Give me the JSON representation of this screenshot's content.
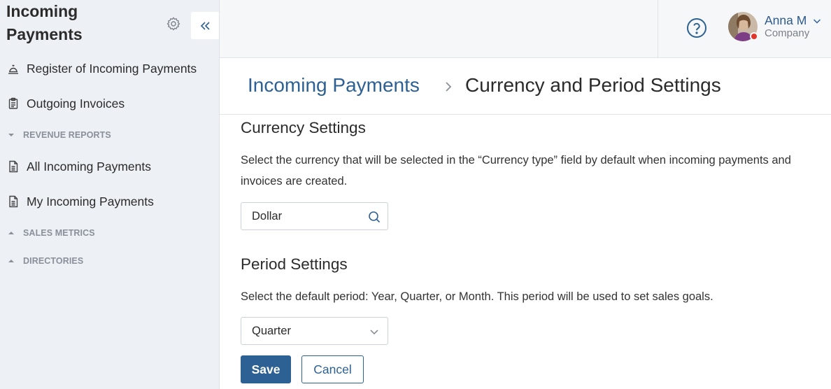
{
  "sidebar": {
    "title": "Incoming Payments",
    "items": [
      {
        "label": "Register of Incoming Payments",
        "icon": "bell-register-icon"
      },
      {
        "label": "Outgoing Invoices",
        "icon": "clipboard-icon"
      },
      {
        "label": "All Incoming Payments",
        "icon": "document-icon"
      },
      {
        "label": "My Incoming Payments",
        "icon": "document-icon"
      }
    ],
    "groups": [
      {
        "label": "REVENUE REPORTS",
        "state": "expanded"
      },
      {
        "label": "SALES METRICS",
        "state": "collapsed"
      },
      {
        "label": "DIRECTORIES",
        "state": "collapsed"
      }
    ]
  },
  "header": {
    "user_name": "Anna M",
    "user_company": "Company"
  },
  "breadcrumb": {
    "parent": "Incoming Payments",
    "current": "Currency and Period Settings"
  },
  "currency": {
    "title": "Currency Settings",
    "description": "Select the currency that will be selected in the “Currency type” field by default when incoming payments and invoices are created.",
    "value": "Dollar"
  },
  "period": {
    "title": "Period Settings",
    "description": "Select the default period: Year, Quarter, or Month. This period will be used to set sales goals.",
    "value": "Quarter"
  },
  "actions": {
    "save": "Save",
    "cancel": "Cancel"
  },
  "colors": {
    "accent": "#2e6193",
    "sidebar_bg": "#edf0f4",
    "status_dot": "#e0352b"
  }
}
